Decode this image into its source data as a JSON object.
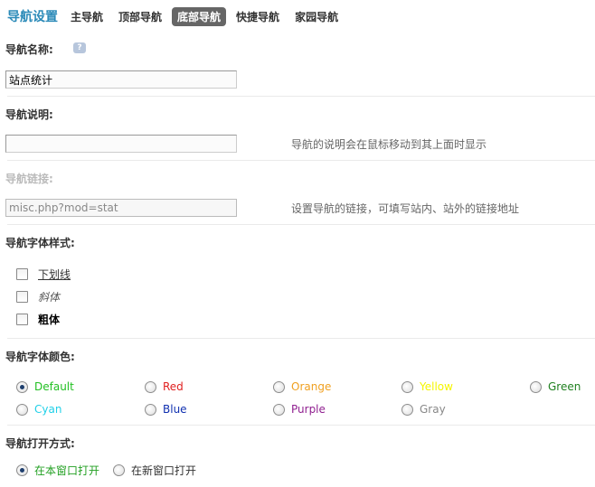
{
  "topnav": {
    "title": "导航设置",
    "tabs": [
      {
        "label": "主导航",
        "active": false
      },
      {
        "label": "顶部导航",
        "active": false
      },
      {
        "label": "底部导航",
        "active": true
      },
      {
        "label": "快捷导航",
        "active": false
      },
      {
        "label": "家园导航",
        "active": false
      }
    ]
  },
  "form": {
    "name": {
      "label": "导航名称:",
      "value": "站点统计"
    },
    "description": {
      "label": "导航说明:",
      "value": "",
      "hint": "导航的说明会在鼠标移动到其上面时显示"
    },
    "link": {
      "label": "导航链接:",
      "value": "misc.php?mod=stat",
      "hint": "设置导航的链接，可填写站内、站外的链接地址"
    },
    "font_style": {
      "label": "导航字体样式:",
      "options": [
        {
          "label": "下划线",
          "checked": false
        },
        {
          "label": "斜体",
          "checked": false
        },
        {
          "label": "粗体",
          "checked": false
        }
      ]
    },
    "font_color": {
      "label": "导航字体颜色:",
      "options": [
        {
          "label": "Default",
          "color": "#22c022",
          "checked": true
        },
        {
          "label": "Red",
          "color": "#e02020",
          "checked": false
        },
        {
          "label": "Orange",
          "color": "#f0a020",
          "checked": false
        },
        {
          "label": "Yellow",
          "color": "#f5f500",
          "checked": false
        },
        {
          "label": "Green",
          "color": "#208020",
          "checked": false
        },
        {
          "label": "Cyan",
          "color": "#20d0e8",
          "checked": false
        },
        {
          "label": "Blue",
          "color": "#1030b0",
          "checked": false
        },
        {
          "label": "Purple",
          "color": "#902090",
          "checked": false
        },
        {
          "label": "Gray",
          "color": "#888888",
          "checked": false
        }
      ]
    },
    "open_mode": {
      "label": "导航打开方式:",
      "options": [
        {
          "label": "在本窗口打开",
          "color": "#22a022",
          "checked": true
        },
        {
          "label": "在新窗口打开",
          "color": "#333333",
          "checked": false
        }
      ]
    }
  }
}
